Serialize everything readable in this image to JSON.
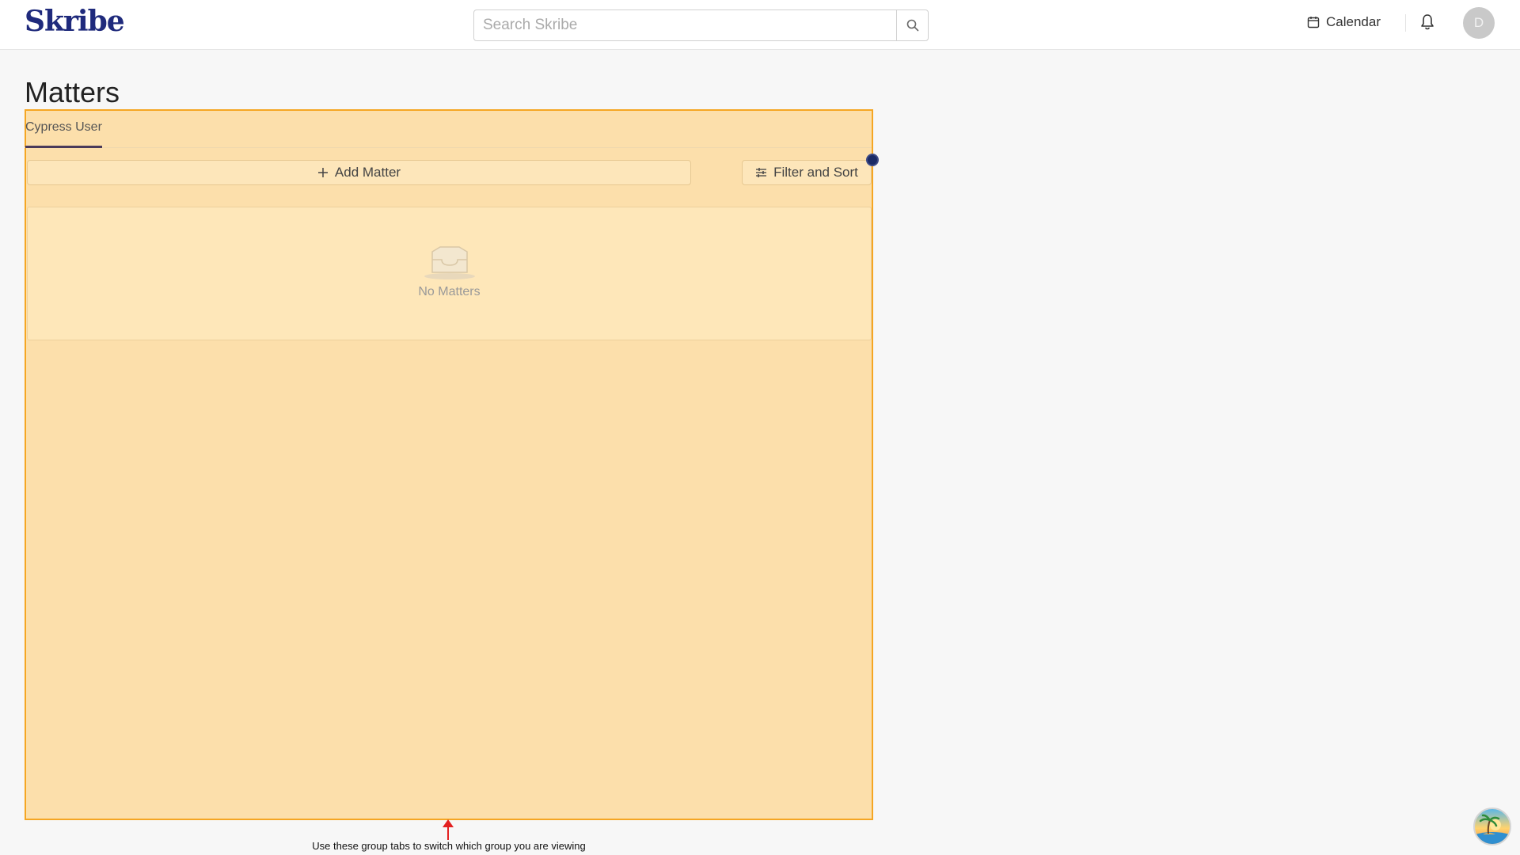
{
  "header": {
    "logo_text": "Skribe",
    "search_placeholder": "Search Skribe",
    "calendar_label": "Calendar",
    "avatar_initial": "D"
  },
  "page": {
    "title": "Matters"
  },
  "tabs": [
    {
      "label": "Cypress User",
      "active": true
    }
  ],
  "toolbar": {
    "add_label": "Add Matter",
    "filter_label": "Filter and Sort"
  },
  "empty_state": {
    "text": "No Matters"
  },
  "tour": {
    "tooltip_text": "Use these group tabs to switch which group you are viewing"
  },
  "colors": {
    "brand": "#1f2a7c",
    "highlight_border": "#f5a623",
    "arrow": "#e32020"
  }
}
